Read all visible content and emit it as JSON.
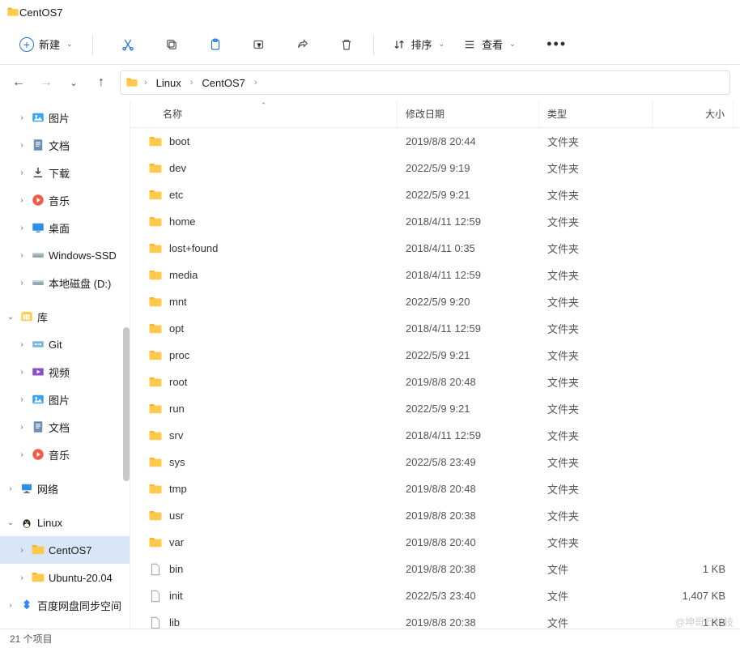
{
  "window": {
    "title": "CentOS7"
  },
  "toolbar": {
    "new_label": "新建",
    "sort_label": "排序",
    "view_label": "查看"
  },
  "breadcrumb": {
    "segments": [
      "Linux",
      "CentOS7"
    ]
  },
  "sidebar": {
    "items": [
      {
        "chev": "›",
        "icon": "pictures",
        "label": "图片",
        "indent": 1
      },
      {
        "chev": "›",
        "icon": "documents",
        "label": "文档",
        "indent": 1
      },
      {
        "chev": "›",
        "icon": "downloads",
        "label": "下载",
        "indent": 1
      },
      {
        "chev": "›",
        "icon": "music",
        "label": "音乐",
        "indent": 1
      },
      {
        "chev": "›",
        "icon": "desktop",
        "label": "桌面",
        "indent": 1
      },
      {
        "chev": "›",
        "icon": "drive",
        "label": "Windows-SSD",
        "indent": 1
      },
      {
        "chev": "›",
        "icon": "drive",
        "label": "本地磁盘 (D:)",
        "indent": 1
      },
      {
        "chev": "⌄",
        "icon": "library",
        "label": "库",
        "indent": 0
      },
      {
        "chev": "›",
        "icon": "git",
        "label": "Git",
        "indent": 1
      },
      {
        "chev": "›",
        "icon": "videos",
        "label": "视频",
        "indent": 1
      },
      {
        "chev": "›",
        "icon": "pictures",
        "label": "图片",
        "indent": 1
      },
      {
        "chev": "›",
        "icon": "documents",
        "label": "文档",
        "indent": 1
      },
      {
        "chev": "›",
        "icon": "music",
        "label": "音乐",
        "indent": 1
      },
      {
        "chev": "›",
        "icon": "network",
        "label": "网络",
        "indent": 0
      },
      {
        "chev": "⌄",
        "icon": "linux",
        "label": "Linux",
        "indent": 0
      },
      {
        "chev": "›",
        "icon": "folder",
        "label": "CentOS7",
        "indent": 1,
        "selected": true
      },
      {
        "chev": "›",
        "icon": "folder",
        "label": "Ubuntu-20.04",
        "indent": 1
      },
      {
        "chev": "›",
        "icon": "baidu",
        "label": "百度网盘同步空间",
        "indent": 0
      }
    ]
  },
  "columns": {
    "name": "名称",
    "date": "修改日期",
    "type": "类型",
    "size": "大小"
  },
  "files": [
    {
      "icon": "folder",
      "name": "boot",
      "date": "2019/8/8 20:44",
      "type": "文件夹",
      "size": ""
    },
    {
      "icon": "folder",
      "name": "dev",
      "date": "2022/5/9 9:19",
      "type": "文件夹",
      "size": ""
    },
    {
      "icon": "folder",
      "name": "etc",
      "date": "2022/5/9 9:21",
      "type": "文件夹",
      "size": ""
    },
    {
      "icon": "folder",
      "name": "home",
      "date": "2018/4/11 12:59",
      "type": "文件夹",
      "size": ""
    },
    {
      "icon": "folder",
      "name": "lost+found",
      "date": "2018/4/11 0:35",
      "type": "文件夹",
      "size": ""
    },
    {
      "icon": "folder",
      "name": "media",
      "date": "2018/4/11 12:59",
      "type": "文件夹",
      "size": ""
    },
    {
      "icon": "folder",
      "name": "mnt",
      "date": "2022/5/9 9:20",
      "type": "文件夹",
      "size": ""
    },
    {
      "icon": "folder",
      "name": "opt",
      "date": "2018/4/11 12:59",
      "type": "文件夹",
      "size": ""
    },
    {
      "icon": "folder",
      "name": "proc",
      "date": "2022/5/9 9:21",
      "type": "文件夹",
      "size": ""
    },
    {
      "icon": "folder",
      "name": "root",
      "date": "2019/8/8 20:48",
      "type": "文件夹",
      "size": ""
    },
    {
      "icon": "folder",
      "name": "run",
      "date": "2022/5/9 9:21",
      "type": "文件夹",
      "size": ""
    },
    {
      "icon": "folder",
      "name": "srv",
      "date": "2018/4/11 12:59",
      "type": "文件夹",
      "size": ""
    },
    {
      "icon": "folder",
      "name": "sys",
      "date": "2022/5/8 23:49",
      "type": "文件夹",
      "size": ""
    },
    {
      "icon": "folder",
      "name": "tmp",
      "date": "2019/8/8 20:48",
      "type": "文件夹",
      "size": ""
    },
    {
      "icon": "folder",
      "name": "usr",
      "date": "2019/8/8 20:38",
      "type": "文件夹",
      "size": ""
    },
    {
      "icon": "folder",
      "name": "var",
      "date": "2019/8/8 20:40",
      "type": "文件夹",
      "size": ""
    },
    {
      "icon": "file",
      "name": "bin",
      "date": "2019/8/8 20:38",
      "type": "文件",
      "size": "1 KB"
    },
    {
      "icon": "file",
      "name": "init",
      "date": "2022/5/3 23:40",
      "type": "文件",
      "size": "1,407 KB"
    },
    {
      "icon": "file",
      "name": "lib",
      "date": "2019/8/8 20:38",
      "type": "文件",
      "size": "1 KB"
    }
  ],
  "status": {
    "text": "21 个项目"
  },
  "watermark": "@坤哥万科技"
}
